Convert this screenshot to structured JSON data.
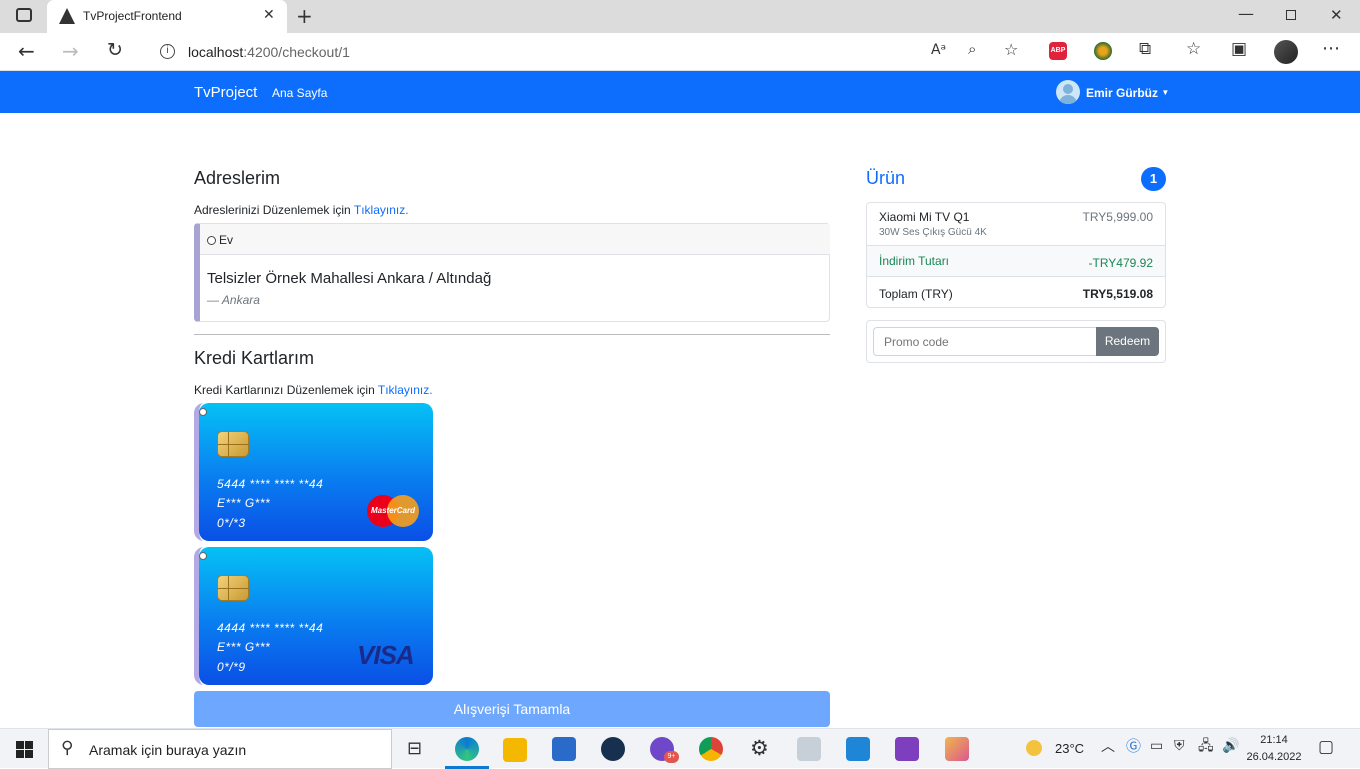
{
  "browser": {
    "tab_title": "TvProjectFrontend",
    "url_host": "localhost",
    "url_path": ":4200/checkout/1",
    "icons": [
      "sidebar-toggle-icon",
      "angular-logo-icon",
      "close-tab-icon",
      "new-tab-icon",
      "minimize-icon",
      "restore-icon",
      "close-window-icon",
      "back-icon",
      "forward-icon",
      "refresh-icon",
      "info-icon",
      "read-aloud-icon",
      "zoom-icon",
      "favorites-add-icon",
      "adblock-icon",
      "extension-icon",
      "extensions-icon",
      "favorites-icon",
      "collections-icon",
      "profile-avatar",
      "more-icon"
    ],
    "abp_label": "ABP"
  },
  "navbar": {
    "brand": "TvProject",
    "home_link": "Ana Sayfa",
    "user_name": "Emir Gürbüz",
    "color": "#0d6efd"
  },
  "addresses": {
    "title": "Adreslerim",
    "edit_text": "Adreslerinizi Düzenlemek için",
    "edit_link": "Tıklayınız.",
    "items": [
      {
        "label": "Ev",
        "address": "Telsizler Örnek Mahallesi Ankara / Altındağ",
        "city": "— Ankara"
      }
    ]
  },
  "cards": {
    "title": "Kredi Kartlarım",
    "edit_text": "Kredi Kartlarınızı Düzenlemek için",
    "edit_link": "Tıklayınız.",
    "items": [
      {
        "number": "5444 **** **** **44",
        "holder": "E*** G***",
        "expiry": "0*/*3",
        "brand": "mastercard",
        "brand_label": "MasterCard"
      },
      {
        "number": "4444 **** **** **44",
        "holder": "E*** G***",
        "expiry": "0*/*9",
        "brand": "visa",
        "brand_label": "VISA"
      }
    ]
  },
  "complete_button": "Alışverişi Tamamla",
  "cart": {
    "title": "Ürün",
    "count": "1",
    "product_name": "Xiaomi Mi TV Q1",
    "product_desc": "30W Ses Çıkış Gücü 4K",
    "product_price": "TRY5,999.00",
    "discount_label": "İndirim Tutarı",
    "discount_value": "-TRY479.92",
    "total_label": "Toplam (TRY)",
    "total_value": "TRY5,519.08",
    "promo_placeholder": "Promo code",
    "redeem_label": "Redeem"
  },
  "taskbar": {
    "search_placeholder": "Aramak için buraya yazın",
    "weather": "23°C",
    "time": "21:14",
    "date": "26.04.2022",
    "badge": "9+"
  }
}
